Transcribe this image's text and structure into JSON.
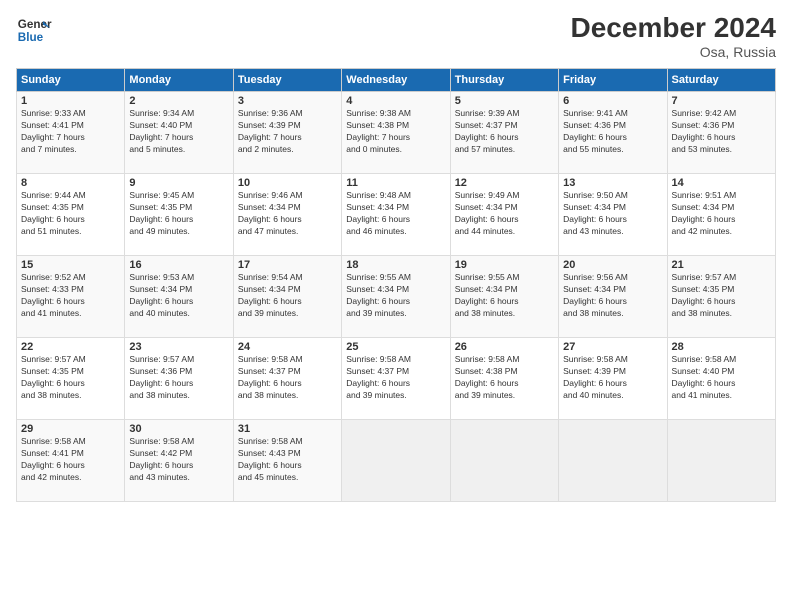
{
  "logo": {
    "line1": "General",
    "line2": "Blue"
  },
  "title": "December 2024",
  "subtitle": "Osa, Russia",
  "days_of_week": [
    "Sunday",
    "Monday",
    "Tuesday",
    "Wednesday",
    "Thursday",
    "Friday",
    "Saturday"
  ],
  "weeks": [
    [
      {
        "day": "1",
        "info": "Sunrise: 9:33 AM\nSunset: 4:41 PM\nDaylight: 7 hours\nand 7 minutes."
      },
      {
        "day": "2",
        "info": "Sunrise: 9:34 AM\nSunset: 4:40 PM\nDaylight: 7 hours\nand 5 minutes."
      },
      {
        "day": "3",
        "info": "Sunrise: 9:36 AM\nSunset: 4:39 PM\nDaylight: 7 hours\nand 2 minutes."
      },
      {
        "day": "4",
        "info": "Sunrise: 9:38 AM\nSunset: 4:38 PM\nDaylight: 7 hours\nand 0 minutes."
      },
      {
        "day": "5",
        "info": "Sunrise: 9:39 AM\nSunset: 4:37 PM\nDaylight: 6 hours\nand 57 minutes."
      },
      {
        "day": "6",
        "info": "Sunrise: 9:41 AM\nSunset: 4:36 PM\nDaylight: 6 hours\nand 55 minutes."
      },
      {
        "day": "7",
        "info": "Sunrise: 9:42 AM\nSunset: 4:36 PM\nDaylight: 6 hours\nand 53 minutes."
      }
    ],
    [
      {
        "day": "8",
        "info": "Sunrise: 9:44 AM\nSunset: 4:35 PM\nDaylight: 6 hours\nand 51 minutes."
      },
      {
        "day": "9",
        "info": "Sunrise: 9:45 AM\nSunset: 4:35 PM\nDaylight: 6 hours\nand 49 minutes."
      },
      {
        "day": "10",
        "info": "Sunrise: 9:46 AM\nSunset: 4:34 PM\nDaylight: 6 hours\nand 47 minutes."
      },
      {
        "day": "11",
        "info": "Sunrise: 9:48 AM\nSunset: 4:34 PM\nDaylight: 6 hours\nand 46 minutes."
      },
      {
        "day": "12",
        "info": "Sunrise: 9:49 AM\nSunset: 4:34 PM\nDaylight: 6 hours\nand 44 minutes."
      },
      {
        "day": "13",
        "info": "Sunrise: 9:50 AM\nSunset: 4:34 PM\nDaylight: 6 hours\nand 43 minutes."
      },
      {
        "day": "14",
        "info": "Sunrise: 9:51 AM\nSunset: 4:34 PM\nDaylight: 6 hours\nand 42 minutes."
      }
    ],
    [
      {
        "day": "15",
        "info": "Sunrise: 9:52 AM\nSunset: 4:33 PM\nDaylight: 6 hours\nand 41 minutes."
      },
      {
        "day": "16",
        "info": "Sunrise: 9:53 AM\nSunset: 4:34 PM\nDaylight: 6 hours\nand 40 minutes."
      },
      {
        "day": "17",
        "info": "Sunrise: 9:54 AM\nSunset: 4:34 PM\nDaylight: 6 hours\nand 39 minutes."
      },
      {
        "day": "18",
        "info": "Sunrise: 9:55 AM\nSunset: 4:34 PM\nDaylight: 6 hours\nand 39 minutes."
      },
      {
        "day": "19",
        "info": "Sunrise: 9:55 AM\nSunset: 4:34 PM\nDaylight: 6 hours\nand 38 minutes."
      },
      {
        "day": "20",
        "info": "Sunrise: 9:56 AM\nSunset: 4:34 PM\nDaylight: 6 hours\nand 38 minutes."
      },
      {
        "day": "21",
        "info": "Sunrise: 9:57 AM\nSunset: 4:35 PM\nDaylight: 6 hours\nand 38 minutes."
      }
    ],
    [
      {
        "day": "22",
        "info": "Sunrise: 9:57 AM\nSunset: 4:35 PM\nDaylight: 6 hours\nand 38 minutes."
      },
      {
        "day": "23",
        "info": "Sunrise: 9:57 AM\nSunset: 4:36 PM\nDaylight: 6 hours\nand 38 minutes."
      },
      {
        "day": "24",
        "info": "Sunrise: 9:58 AM\nSunset: 4:37 PM\nDaylight: 6 hours\nand 38 minutes."
      },
      {
        "day": "25",
        "info": "Sunrise: 9:58 AM\nSunset: 4:37 PM\nDaylight: 6 hours\nand 39 minutes."
      },
      {
        "day": "26",
        "info": "Sunrise: 9:58 AM\nSunset: 4:38 PM\nDaylight: 6 hours\nand 39 minutes."
      },
      {
        "day": "27",
        "info": "Sunrise: 9:58 AM\nSunset: 4:39 PM\nDaylight: 6 hours\nand 40 minutes."
      },
      {
        "day": "28",
        "info": "Sunrise: 9:58 AM\nSunset: 4:40 PM\nDaylight: 6 hours\nand 41 minutes."
      }
    ],
    [
      {
        "day": "29",
        "info": "Sunrise: 9:58 AM\nSunset: 4:41 PM\nDaylight: 6 hours\nand 42 minutes."
      },
      {
        "day": "30",
        "info": "Sunrise: 9:58 AM\nSunset: 4:42 PM\nDaylight: 6 hours\nand 43 minutes."
      },
      {
        "day": "31",
        "info": "Sunrise: 9:58 AM\nSunset: 4:43 PM\nDaylight: 6 hours\nand 45 minutes."
      },
      {
        "day": "",
        "info": ""
      },
      {
        "day": "",
        "info": ""
      },
      {
        "day": "",
        "info": ""
      },
      {
        "day": "",
        "info": ""
      }
    ]
  ]
}
